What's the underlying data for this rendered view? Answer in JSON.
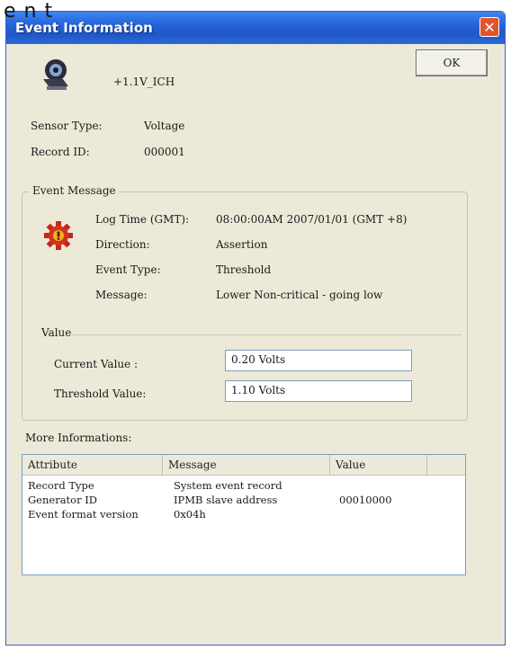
{
  "overlay_text": "e n t",
  "window": {
    "title": "Event Information",
    "close_glyph": "✕"
  },
  "sensor": {
    "name": "+1.1V_ICH",
    "icon": "sensor-icon"
  },
  "buttons": {
    "ok_label": "OK"
  },
  "fields": {
    "sensor_type_label": "Sensor Type:",
    "sensor_type_value": "Voltage",
    "record_id_label": "Record ID:",
    "record_id_value": "000001"
  },
  "event_message": {
    "group_title": "Event Message",
    "icon": "warning-gear-icon",
    "log_time_label": "Log Time (GMT):",
    "log_time_value": "08:00:00AM 2007/01/01 (GMT +8)",
    "direction_label": "Direction:",
    "direction_value": "Assertion",
    "event_type_label": "Event Type:",
    "event_type_value": "Threshold",
    "message_label": "Message:",
    "message_value": "Lower Non-critical - going low"
  },
  "value_section": {
    "title": "Value",
    "current_label": "Current Value :",
    "current_value": "0.20 Volts",
    "threshold_label": "Threshold Value:",
    "threshold_value": "1.10 Volts"
  },
  "more_info": {
    "title": "More Informations:",
    "columns": [
      "Attribute",
      "Message",
      "Value"
    ],
    "rows": [
      [
        "Record Type",
        "System event record",
        ""
      ],
      [
        "Generator ID",
        "IPMB slave address",
        "00010000"
      ],
      [
        "Event format version",
        "0x04h",
        ""
      ]
    ]
  },
  "colors": {
    "titlebar": "#2563d8",
    "close": "#e0542e",
    "dialog_bg": "#ece9d8"
  }
}
